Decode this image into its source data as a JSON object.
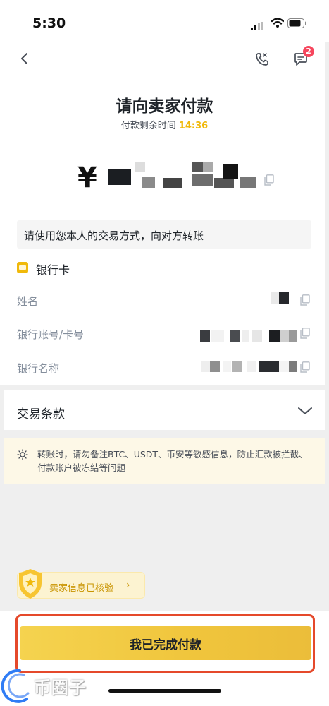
{
  "status_bar": {
    "time": "5:30",
    "signal_icon": "signal-icon",
    "wifi_icon": "wifi-icon",
    "battery_icon": "battery-icon"
  },
  "nav": {
    "back_icon": "chevron-left-icon",
    "call_icon": "phone-icon",
    "chat_icon": "chat-icon",
    "chat_badge": "2"
  },
  "header": {
    "title": "请向卖家付款",
    "timer_label": "付款剩余时间",
    "timer_value": "14:36"
  },
  "amount": {
    "currency_symbol": "¥"
  },
  "notice": {
    "text": "请使用您本人的交易方式，向对方转账"
  },
  "payment_method": {
    "name": "银行卡",
    "fields": [
      {
        "label": "姓名"
      },
      {
        "label": "银行账号/卡号"
      },
      {
        "label": "银行名称"
      }
    ]
  },
  "terms": {
    "label": "交易条款"
  },
  "warning": {
    "text": "转账时，请勿备注BTC、USDT、币安等敏感信息，防止汇款被拦截、付款账户被冻结等问题"
  },
  "verified": {
    "text": "卖家信息已核验"
  },
  "confirm": {
    "label": "我已完成付款"
  },
  "watermark": {
    "text": "币圈子"
  },
  "colors": {
    "accent": "#f0b90b",
    "badge": "#f6465d",
    "highlight_border": "#e5492b"
  }
}
